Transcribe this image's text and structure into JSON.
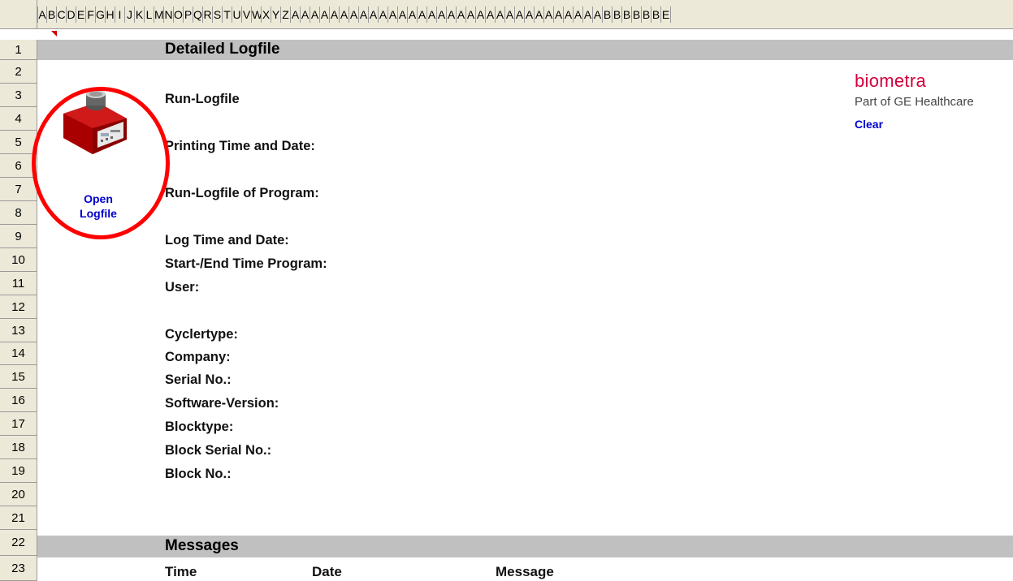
{
  "columns": [
    "A",
    "B",
    "C",
    "D",
    "E",
    "F",
    "G",
    "H",
    "I",
    "J",
    "K",
    "L",
    "M",
    "N",
    "O",
    "P",
    "Q",
    "R",
    "S",
    "T",
    "U",
    "V",
    "W",
    "X",
    "Y",
    "Z",
    "A",
    "A",
    "A",
    "A",
    "A",
    "A",
    "A",
    "A",
    "A",
    "A",
    "A",
    "A",
    "A",
    "A",
    "A",
    "A",
    "A",
    "A",
    "A",
    "A",
    "A",
    "A",
    "A",
    "A",
    "A",
    "A",
    "A",
    "A",
    "A",
    "A",
    "A",
    "A",
    "B",
    "B",
    "B",
    "B",
    "B",
    "B",
    "E"
  ],
  "rows": [
    "1",
    "2",
    "3",
    "4",
    "5",
    "6",
    "7",
    "8",
    "9",
    "10",
    "11",
    "12",
    "13",
    "14",
    "15",
    "16",
    "17",
    "18",
    "19",
    "20",
    "21",
    "22",
    "23"
  ],
  "sheet": {
    "title": "Detailed Logfile",
    "run_logfile": "Run-Logfile",
    "printing_time": "Printing Time and Date:",
    "run_logfile_program": "Run-Logfile of Program:",
    "log_time": "Log Time and Date:",
    "start_end": "Start-/End Time Program:",
    "user": "User:",
    "cyclertype": "Cyclertype:",
    "company": "Company:",
    "serial": "Serial No.:",
    "software": "Software-Version:",
    "blocktype": "Blocktype:",
    "block_serial": "Block Serial No.:",
    "block_no": "Block No.:",
    "messages": "Messages",
    "col_time": "Time",
    "col_date": "Date",
    "col_message": "Message"
  },
  "open_logfile": {
    "line1": "Open",
    "line2": "Logfile"
  },
  "logo": {
    "brand": "biometra",
    "sub": "Part of GE Healthcare",
    "clear": "Clear",
    "brand_color": "#d2003c"
  }
}
